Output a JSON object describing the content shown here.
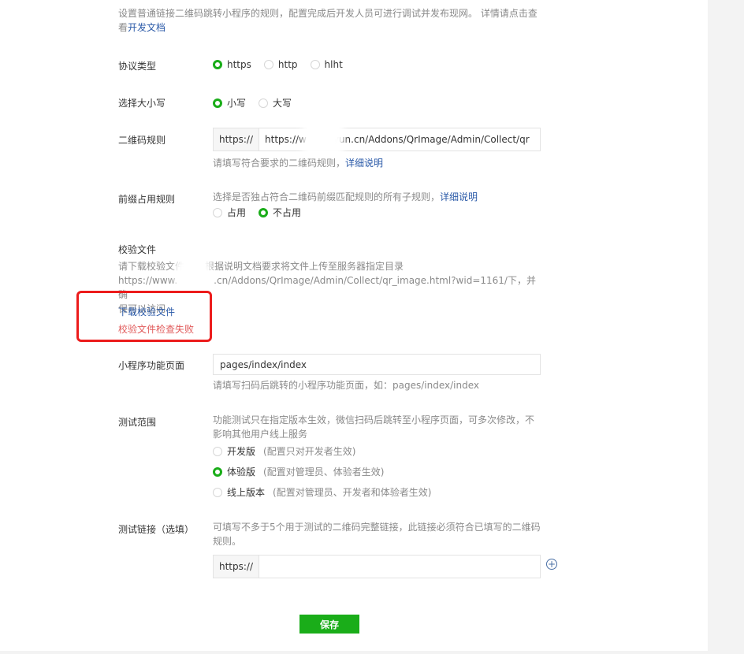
{
  "intro": {
    "line1": "设置普通链接二维码跳转小程序的规则，配置完成后开发人员可进行调试并发布现网。 详情请点击查",
    "line2_prefix": "看",
    "dev_doc_link": "开发文档"
  },
  "protocol": {
    "label": "协议类型",
    "options": [
      "https",
      "http",
      "hlht"
    ],
    "selected": "https"
  },
  "case": {
    "label": "选择大小写",
    "options": [
      "小写",
      "大写"
    ],
    "selected": "小写"
  },
  "qr_rule": {
    "label": "二维码规则",
    "prefix": "https://",
    "value_start": "https://w",
    "value_end": "yun.cn/Addons/QrImage/Admin/Collect/qr",
    "hint": "请填写符合要求的二维码规则，",
    "hint_link": "详细说明"
  },
  "prefix_rule": {
    "label": "前缀占用规则",
    "desc": "选择是否独占符合二维码前缀匹配规则的所有子规则，",
    "desc_link": "详细说明",
    "options": [
      "占用",
      "不占用"
    ],
    "selected": "不占用"
  },
  "verify": {
    "label": "校验文件",
    "desc_line1_a": "请下载校验文件",
    "desc_line1_b": "根据说明文档要求将文件上传至服务器指定目录",
    "desc_line2_a": "https://www.",
    "desc_line2_b": ".cn/Addons/QrImage/Admin/Collect/qr_image.html?wid=1161/下，并确",
    "desc_line3": "保可以访问",
    "download_link": "下载校验文件",
    "error": "校验文件检查失败"
  },
  "page": {
    "label": "小程序功能页面",
    "value": "pages/index/index",
    "hint": "请填写扫码后跳转的小程序功能页面，如：pages/index/index"
  },
  "test_scope": {
    "label": "测试范围",
    "desc_line1": "功能测试只在指定版本生效，微信扫码后跳转至小程序页面，可多次修改，不",
    "desc_line2": "影响其他用户线上服务",
    "options": [
      {
        "label": "开发版",
        "note": "(配置只对开发者生效)"
      },
      {
        "label": "体验版",
        "note": "(配置对管理员、体验者生效)"
      },
      {
        "label": "线上版本",
        "note": "(配置对管理员、开发者和体验者生效)"
      }
    ],
    "selected": "体验版"
  },
  "test_link": {
    "label": "测试链接（选填）",
    "desc_line1": "可填写不多于5个用于测试的二维码完整链接，此链接必须符合已填写的二维码",
    "desc_line2": "规则。",
    "prefix": "https://",
    "value": ""
  },
  "save_label": "保存",
  "colors": {
    "accent": "#1aad19",
    "link": "#2b5aa8",
    "error": "#e15b5b",
    "annotation": "#ec1c1c"
  }
}
